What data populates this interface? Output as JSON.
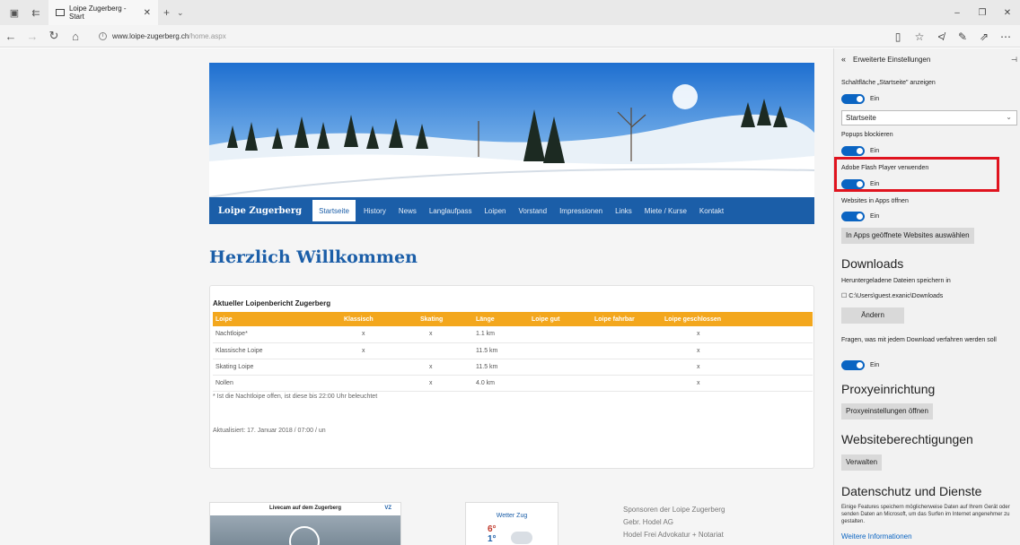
{
  "browser": {
    "tab_title": "Loipe Zugerberg - Start",
    "url_domain": "www.loipe-zugerberg.ch",
    "url_path": "/home.aspx"
  },
  "site": {
    "brand": "Loipe Zugerberg",
    "nav": [
      "Startseite",
      "History",
      "News",
      "Langlaufpass",
      "Loipen",
      "Vorstand",
      "Impressionen",
      "Links",
      "Miete / Kurse",
      "Kontakt"
    ],
    "welcome": "Herzlich Willkommen",
    "report_title": "Aktueller Loipenbericht Zugerberg",
    "table_headers": [
      "Loipe",
      "Klassisch",
      "Skating",
      "Länge",
      "Loipe gut",
      "Loipe fahrbar",
      "Loipe geschlossen"
    ],
    "table_rows": [
      [
        "Nachtloipe*",
        "x",
        "x",
        "1.1 km",
        "",
        "",
        "x"
      ],
      [
        "Klassische Loipe",
        "x",
        "",
        "11.5 km",
        "",
        "",
        "x"
      ],
      [
        "Skating Loipe",
        "",
        "x",
        "11.5 km",
        "",
        "",
        "x"
      ],
      [
        "Nollen",
        "",
        "x",
        "4.0 km",
        "",
        "",
        "x"
      ]
    ],
    "note": "* Ist die Nachtloipe offen, ist diese bis 22:00 Uhr beleuchtet",
    "updated": "Aktualisiert: 17. Januar 2018 / 07:00 / un",
    "livecam_title": "Livecam auf dem Zugerberg",
    "livecam_logo": "VZ",
    "weather_title": "Wetter Zug",
    "weather_hi": "6°",
    "weather_lo": "1°",
    "sponsors_title": "Sponsoren der Loipe Zugerberg",
    "sponsors": [
      "Gebr. Hodel AG",
      "Hodel Frei Advokatur + Notariat"
    ]
  },
  "settings": {
    "header": "Erweiterte Einstellungen",
    "home_button_label": "Schaltfläche „Startseite\" anzeigen",
    "on": "Ein",
    "home_select": "Startseite",
    "popups_label": "Popups blockieren",
    "flash_label": "Adobe Flash Player verwenden",
    "apps_label": "Websites in Apps öffnen",
    "apps_button": "In Apps geöffnete Websites auswählen",
    "downloads_heading": "Downloads",
    "downloads_label": "Heruntergeladene Dateien speichern in",
    "downloads_path": "C:\\Users\\guest.exanic\\Downloads",
    "change_button": "Ändern",
    "ask_label": "Fragen, was mit jedem Download verfahren werden soll",
    "proxy_heading": "Proxyeinrichtung",
    "proxy_button": "Proxyeinstellungen öffnen",
    "perm_heading": "Websiteberechtigungen",
    "manage_button": "Verwalten",
    "privacy_heading": "Datenschutz und Dienste",
    "privacy_text": "Einige Features speichern möglicherweise Daten auf Ihrem Gerät oder senden Daten an Microsoft, um das Surfen im Internet angenehmer zu gestalten.",
    "more_info": "Weitere Informationen"
  }
}
